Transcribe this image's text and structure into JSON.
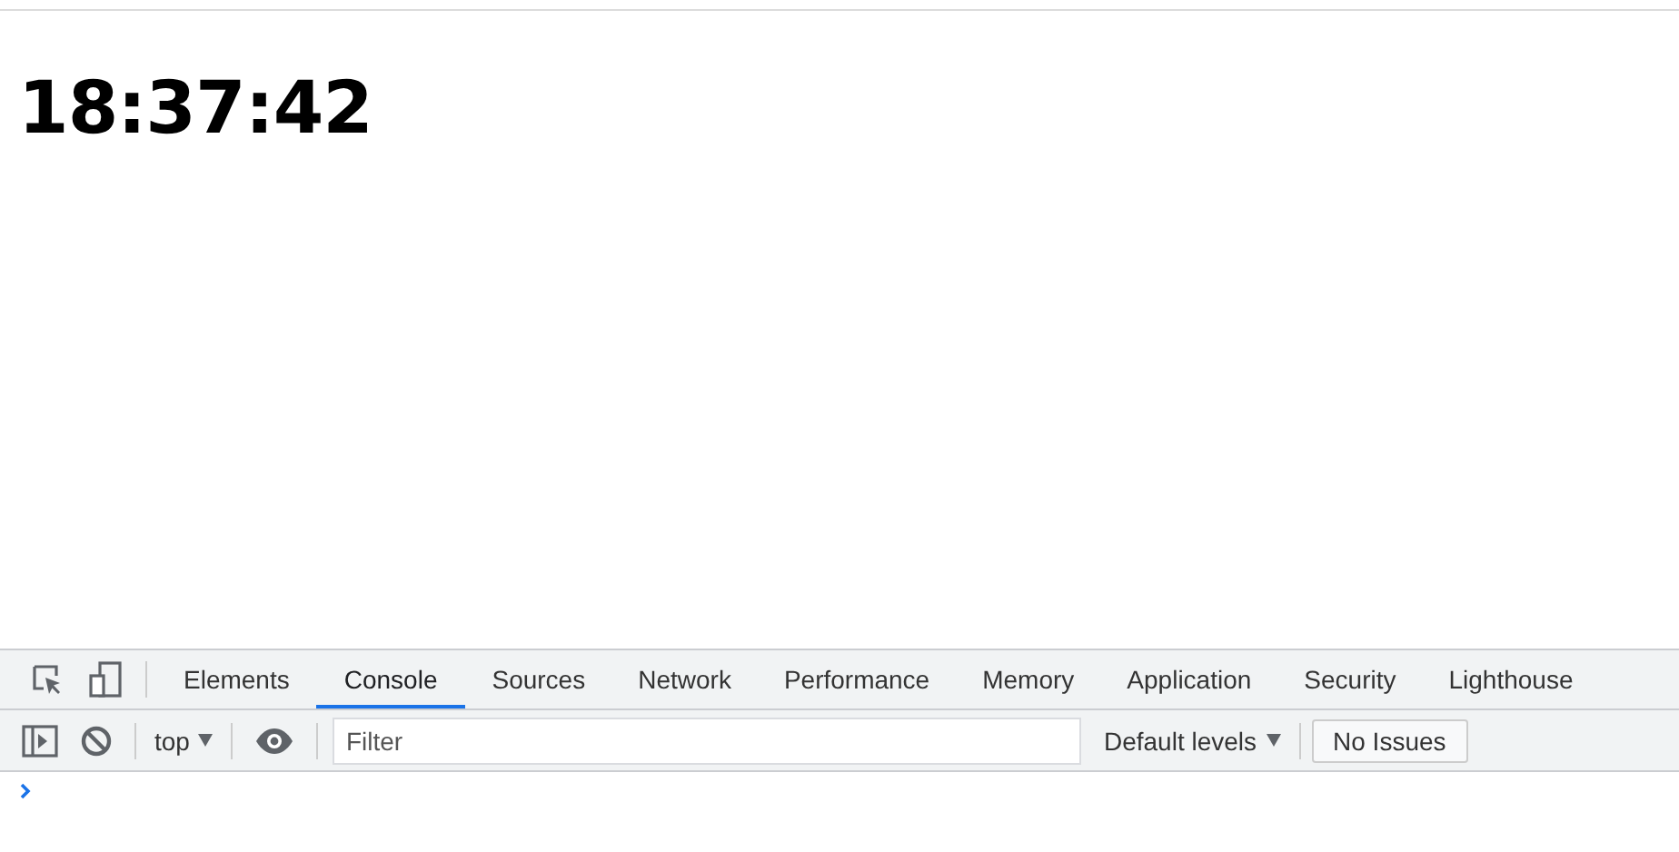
{
  "page": {
    "clock": "18:37:42"
  },
  "devtools": {
    "tabs": [
      {
        "label": "Elements",
        "selected": false
      },
      {
        "label": "Console",
        "selected": true
      },
      {
        "label": "Sources",
        "selected": false
      },
      {
        "label": "Network",
        "selected": false
      },
      {
        "label": "Performance",
        "selected": false
      },
      {
        "label": "Memory",
        "selected": false
      },
      {
        "label": "Application",
        "selected": false
      },
      {
        "label": "Security",
        "selected": false
      },
      {
        "label": "Lighthouse",
        "selected": false
      }
    ],
    "context": "top",
    "filter": {
      "placeholder": "Filter"
    },
    "levels": "Default levels",
    "issues": "No Issues"
  }
}
